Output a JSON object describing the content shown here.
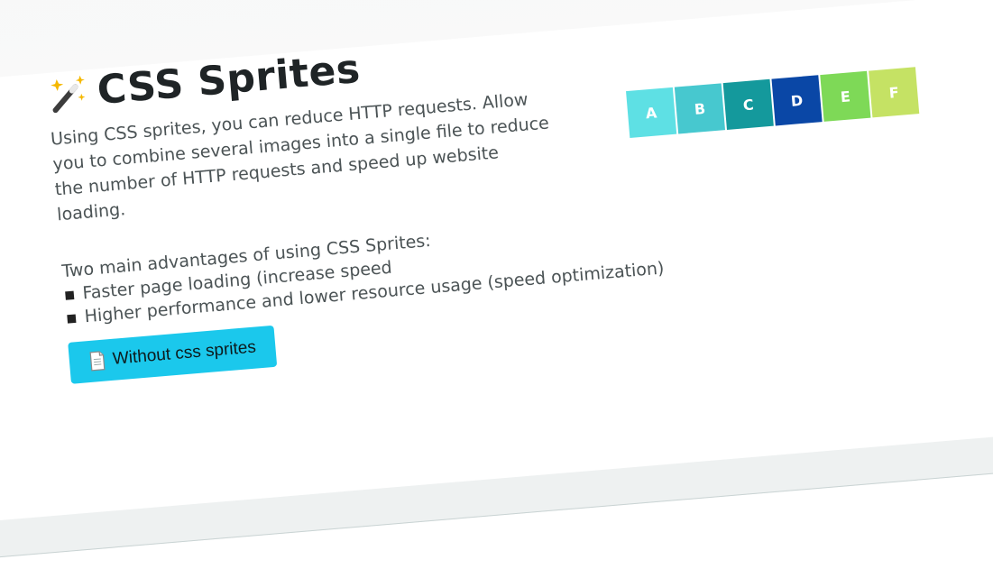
{
  "header": {
    "title": "CSS Sprites",
    "icon": "magic-wand-icon"
  },
  "description": "Using CSS sprites, you can reduce HTTP requests. Allow you to combine several images into a single file to reduce the number of HTTP requests and speed up website loading.",
  "advantages": {
    "heading": "Two main advantages of using CSS Sprites:",
    "items": [
      "Faster page loading (increase speed",
      "Higher performance and lower resource usage (speed optimization)"
    ]
  },
  "button": {
    "label": "Without css sprites",
    "icon": "document-icon",
    "color": "#1bc8ec"
  },
  "sprites": [
    {
      "label": "A",
      "color": "#5ee0e4"
    },
    {
      "label": "B",
      "color": "#47c8cf"
    },
    {
      "label": "C",
      "color": "#14999c"
    },
    {
      "label": "D",
      "color": "#0a47a6"
    },
    {
      "label": "E",
      "color": "#7ed957"
    },
    {
      "label": "F",
      "color": "#c5e264"
    }
  ]
}
